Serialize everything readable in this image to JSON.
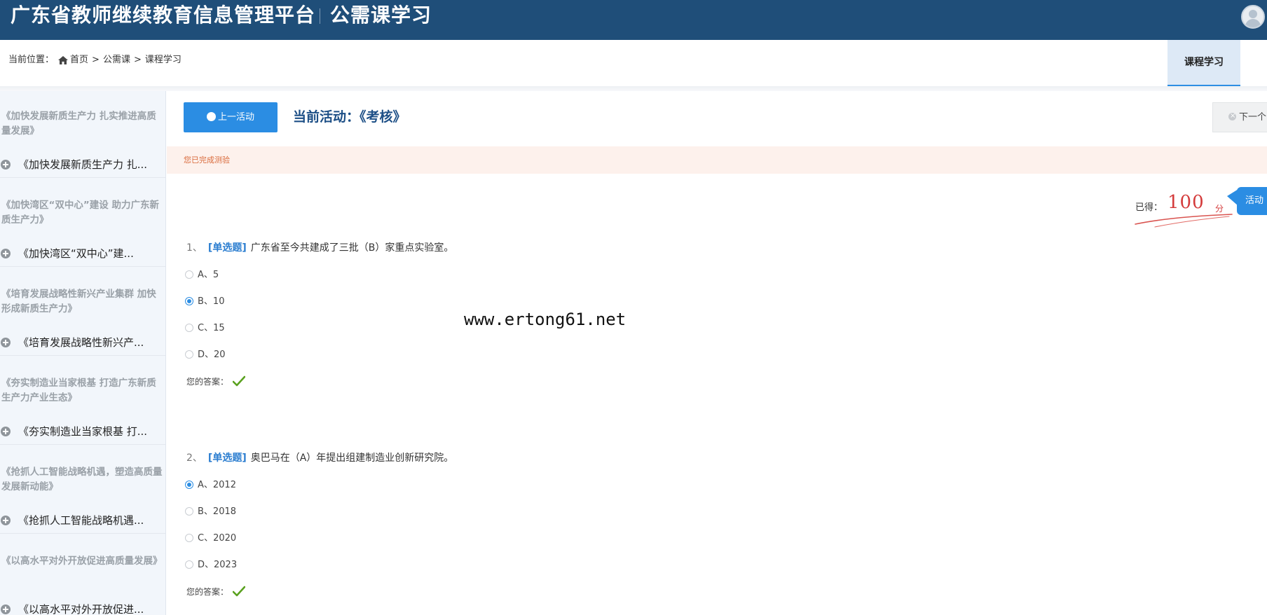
{
  "header": {
    "site_title": "广东省教师继续教育信息管理平台",
    "section_title": "公需课学习"
  },
  "breadcrumb": {
    "label": "当前位置：",
    "items": [
      "首页",
      "公需课",
      "课程学习"
    ],
    "separator": ">"
  },
  "tabs": {
    "active": "课程学习"
  },
  "sidebar": {
    "groups": [
      {
        "title": "《加快发展新质生产力 扎实推进高质量发展》",
        "item": "《加快发展新质生产力 扎..."
      },
      {
        "title": "《加快湾区“双中心”建设 助力广东新质生产力》",
        "item": "《加快湾区“双中心”建..."
      },
      {
        "title": "《培育发展战略性新兴产业集群 加快形成新质生产力》",
        "item": "《培育发展战略性新兴产..."
      },
      {
        "title": "《夯实制造业当家根基 打造广东新质生产力产业生态》",
        "item": "《夯实制造业当家根基 打..."
      },
      {
        "title": "《抢抓人工智能战略机遇，塑造高质量发展新动能》",
        "item": "《抢抓人工智能战略机遇..."
      },
      {
        "title": "《以高水平对外开放促进高质量发展》",
        "item": "《以高水平对外开放促进..."
      }
    ]
  },
  "activity": {
    "prev_label": "上一活动",
    "current_label": "当前活动：《考核》",
    "next_label": "下一个",
    "notice": "您已完成测验",
    "side_tab": "活动"
  },
  "score": {
    "label": "已得：",
    "value": "100",
    "unit": "分"
  },
  "questions": [
    {
      "number": "1、",
      "type": "[单选题]",
      "text": "广东省至今共建成了三批（B）家重点实验室。",
      "options": [
        "A、5",
        "B、10",
        "C、15",
        "D、20"
      ],
      "selected": 1,
      "answer_label": "您的答案："
    },
    {
      "number": "2、",
      "type": "[单选题]",
      "text": "奥巴马在（A）年提出组建制造业创新研究院。",
      "options": [
        "A、2012",
        "B、2018",
        "C、2020",
        "D、2023"
      ],
      "selected": 0,
      "answer_label": "您的答案："
    }
  ],
  "watermark": "www.ertong61.net",
  "colors": {
    "header_bg": "#1f4e79",
    "accent": "#2b8de3",
    "score_red": "#d43b3b",
    "notice_bg": "#fdf1ec",
    "check_green": "#5aa11f"
  }
}
